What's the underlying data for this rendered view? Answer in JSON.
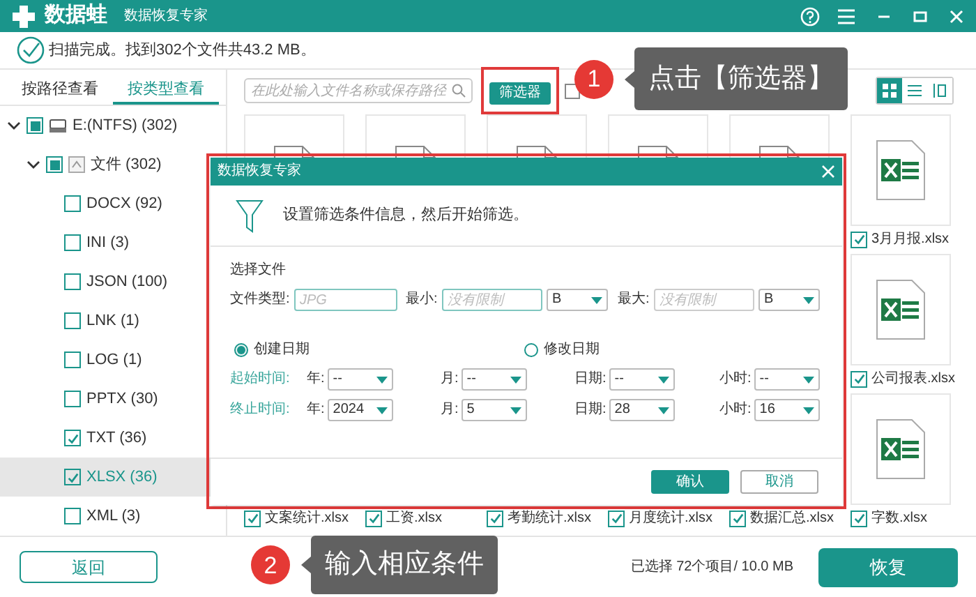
{
  "window": {
    "app_name": "数据蛙",
    "subtitle": "数据恢复专家"
  },
  "status": "扫描完成。找到302个文件共43.2 MB。",
  "tabs": [
    {
      "label": "按路径查看",
      "selected": false
    },
    {
      "label": "按类型查看",
      "selected": true
    }
  ],
  "tree": [
    {
      "label": "E:(NTFS) (302)",
      "kind": "drive",
      "expanded": true,
      "mixed": true,
      "selected": false,
      "children": [
        {
          "label": "文件 (302)",
          "kind": "folder",
          "expanded": true,
          "mixed": true,
          "selected": false,
          "children": [
            {
              "label": "DOCX (92)",
              "checked": false,
              "selected": false
            },
            {
              "label": "INI (3)",
              "checked": false,
              "selected": false
            },
            {
              "label": "JSON (100)",
              "checked": false,
              "selected": false
            },
            {
              "label": "LNK (1)",
              "checked": false,
              "selected": false
            },
            {
              "label": "LOG (1)",
              "checked": false,
              "selected": false
            },
            {
              "label": "PPTX (30)",
              "checked": false,
              "selected": false
            },
            {
              "label": "TXT (36)",
              "checked": true,
              "selected": false
            },
            {
              "label": "XLSX (36)",
              "checked": true,
              "selected": true
            },
            {
              "label": "XML (3)",
              "checked": false,
              "selected": false
            }
          ]
        }
      ]
    }
  ],
  "search": {
    "placeholder": "在此处输入文件名称或保存路径"
  },
  "filter_button": "筛选器",
  "show_deleted": {
    "checked": false
  },
  "view_modes": [
    {
      "kind": "grid",
      "selected": true
    },
    {
      "kind": "list",
      "selected": false
    },
    {
      "kind": "detail",
      "selected": false
    }
  ],
  "file_grid": [
    {
      "cells": [
        {
          "name": "3月月报.xlsx",
          "checked": true
        }
      ]
    },
    {
      "cells": [
        {
          "name": "公司报表.xlsx",
          "checked": true
        }
      ]
    },
    {
      "cells": [
        {
          "name": "文案统计.xlsx",
          "checked": true
        },
        {
          "name": "工资.xlsx",
          "checked": true
        },
        {
          "name": "考勤统计.xlsx",
          "checked": true
        },
        {
          "name": "月度统计.xlsx",
          "checked": true
        },
        {
          "name": "数据汇总.xlsx",
          "checked": true
        },
        {
          "name": "字数.xlsx",
          "checked": true
        }
      ]
    }
  ],
  "dialog": {
    "title": "数据恢复专家",
    "message": "设置筛选条件信息，然后开始筛选。",
    "section": "选择文件",
    "file_type": {
      "label": "文件类型:",
      "placeholder": "JPG"
    },
    "min_size": {
      "label": "最小:",
      "placeholder": "没有限制",
      "unit": "B"
    },
    "max_size": {
      "label": "最大:",
      "placeholder": "没有限制",
      "unit": "B"
    },
    "date_modes": [
      {
        "label": "创建日期",
        "selected": true
      },
      {
        "label": "修改日期",
        "selected": false
      }
    ],
    "time_rows": [
      {
        "label": "起始时间:",
        "fields": [
          {
            "label": "年:",
            "value": "--"
          },
          {
            "label": "月:",
            "value": "--"
          },
          {
            "label": "日期:",
            "value": "--"
          },
          {
            "label": "小时:",
            "value": "--"
          }
        ]
      },
      {
        "label": "终止时间:",
        "fields": [
          {
            "label": "年:",
            "value": "2024"
          },
          {
            "label": "月:",
            "value": "5"
          },
          {
            "label": "日期:",
            "value": "28"
          },
          {
            "label": "小时:",
            "value": "16"
          }
        ]
      }
    ],
    "buttons": [
      {
        "label": "确认",
        "kind": "primary"
      },
      {
        "label": "取消",
        "kind": "secondary"
      }
    ]
  },
  "callouts": [
    {
      "number": "1",
      "text": "点击【筛选器】"
    },
    {
      "number": "2",
      "text": "输入相应条件"
    }
  ],
  "footer": {
    "back": "返回",
    "summary": "已选择 72个项目/ 10.0 MB",
    "recover": "恢复"
  }
}
